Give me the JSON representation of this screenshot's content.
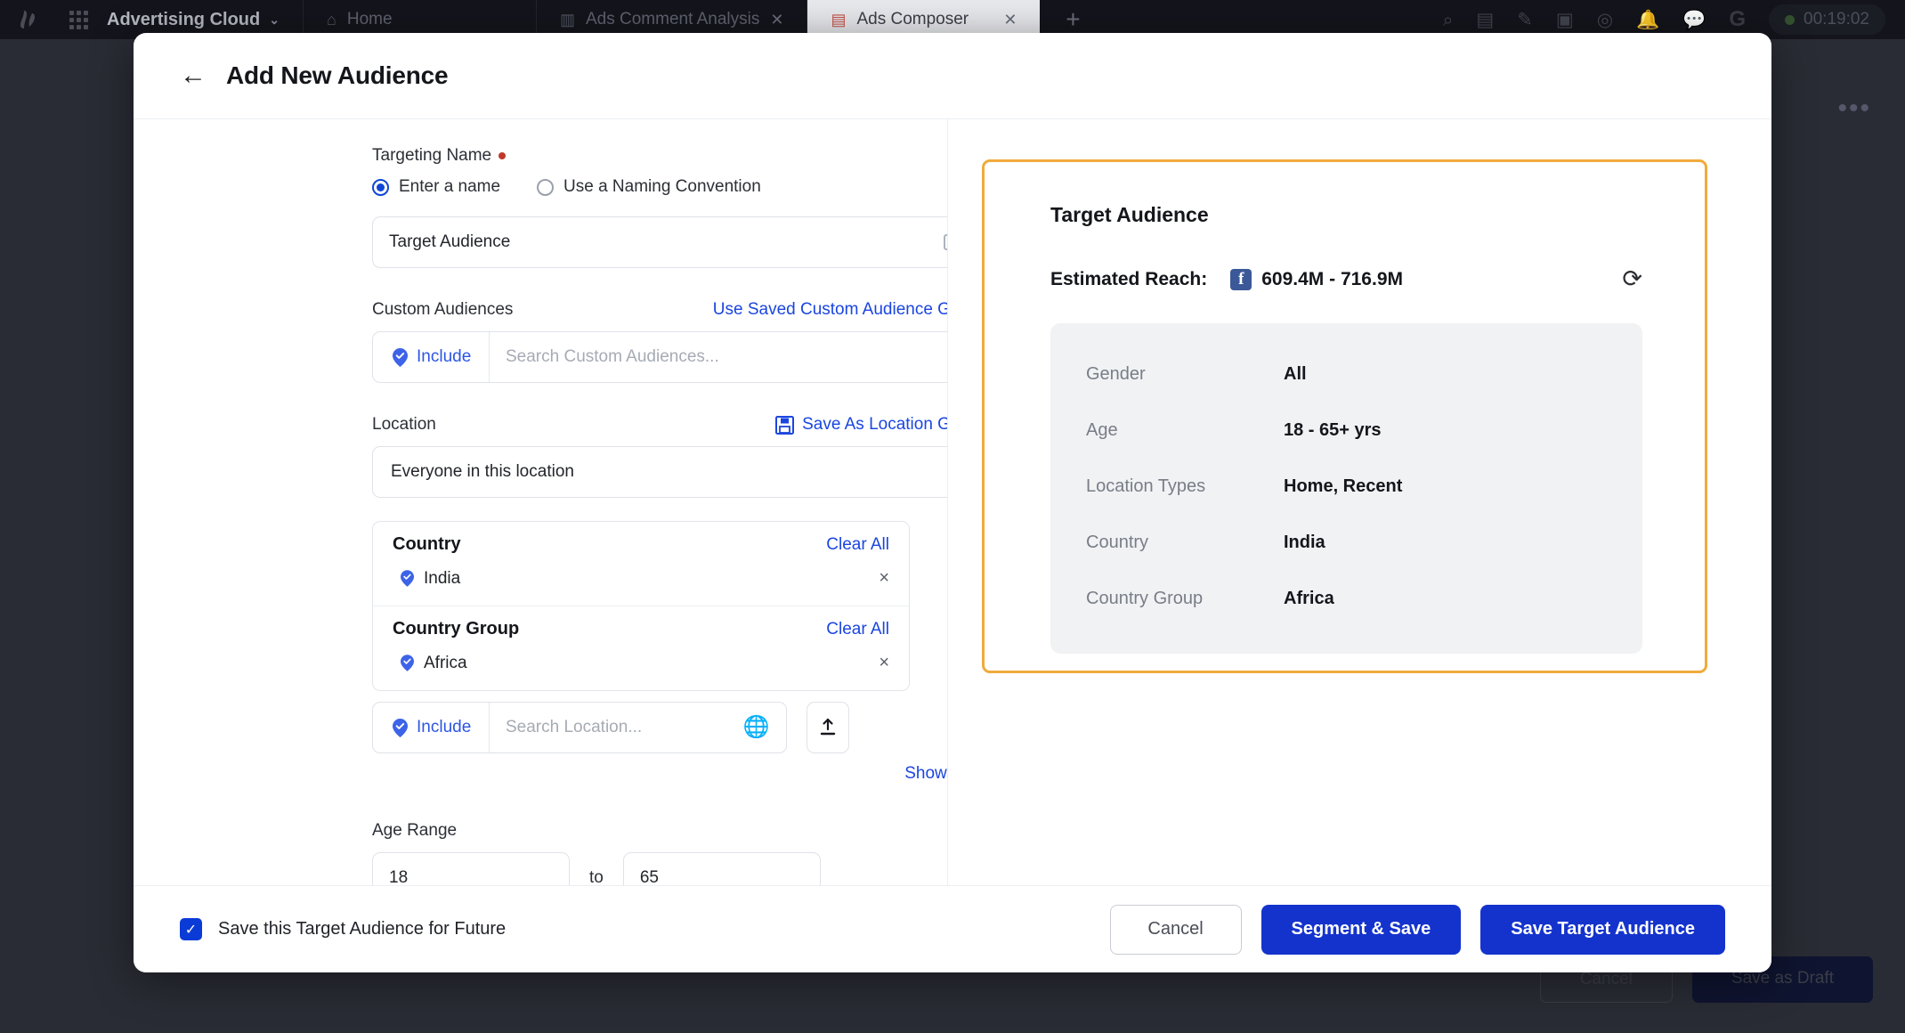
{
  "topbar": {
    "brand": "Advertising Cloud",
    "brand_chevron": "chevron-down",
    "tabs": [
      {
        "label": "Home",
        "icon": "home-icon",
        "active": false,
        "closable": false
      },
      {
        "label": "Ads Comment Analysis",
        "icon": "chart-icon",
        "active": false,
        "closable": true
      },
      {
        "label": "Ads Composer",
        "icon": "composer-icon",
        "active": true,
        "closable": true
      }
    ],
    "new_tab_label": "+",
    "icons": [
      "search-icon",
      "calendar-icon",
      "pencil-icon",
      "schedule-icon",
      "help-icon",
      "bell-icon",
      "chat-icon",
      "google-icon"
    ],
    "clock": "00:19:02"
  },
  "background": {
    "more_menu": "•••",
    "cancel_label": "Cancel",
    "draft_label": "Save as Draft"
  },
  "modal": {
    "title": "Add New Audience",
    "back_icon": "back-arrow-icon"
  },
  "form": {
    "targeting_name": {
      "label": "Targeting Name",
      "required": true,
      "options": [
        {
          "label": "Enter a name",
          "selected": true
        },
        {
          "label": "Use a Naming Convention",
          "selected": false
        }
      ],
      "value": "Target Audience",
      "trailing_icon": "contact-card-icon"
    },
    "custom_audiences": {
      "label": "Custom Audiences",
      "link": "Use Saved Custom Audience Group",
      "include_label": "Include",
      "placeholder": "Search Custom Audiences..."
    },
    "location": {
      "label": "Location",
      "save_link": "Save As Location Group",
      "save_icon": "floppy-disk-icon",
      "dropdown_value": "Everyone in this location",
      "groups": [
        {
          "title": "Country",
          "clear_label": "Clear All",
          "items": [
            {
              "label": "India",
              "icon": "map-pin-check-icon",
              "remove": "×"
            }
          ]
        },
        {
          "title": "Country Group",
          "clear_label": "Clear All",
          "items": [
            {
              "label": "Africa",
              "icon": "map-pin-check-icon",
              "remove": "×"
            }
          ]
        }
      ],
      "include_label": "Include",
      "search_placeholder": "Search Location...",
      "globe_icon": "globe-icon",
      "upload_icon": "upload-icon",
      "show_map_link": "Show Map"
    },
    "age_range": {
      "label": "Age Range",
      "from": "18",
      "to_label": "to",
      "to": "65"
    }
  },
  "preview": {
    "title": "Target Audience",
    "reach_label": "Estimated Reach:",
    "platform_icon": "facebook-icon",
    "reach_value": "609.4M - 716.9M",
    "refresh_icon": "refresh-icon",
    "rows": [
      {
        "key": "Gender",
        "value": "All"
      },
      {
        "key": "Age",
        "value": "18 - 65+ yrs"
      },
      {
        "key": "Location Types",
        "value": "Home, Recent"
      },
      {
        "key": "Country",
        "value": "India"
      },
      {
        "key": "Country Group",
        "value": "Africa"
      }
    ]
  },
  "footer": {
    "checkbox_checked": true,
    "checkbox_label": "Save this Target Audience for Future",
    "cancel": "Cancel",
    "segment_save": "Segment & Save",
    "save_target": "Save Target Audience"
  },
  "colors": {
    "accent_blue": "#1433cd",
    "link_blue": "#1a46e0",
    "highlight_orange": "#f0ab3c",
    "required_red": "#c0392b",
    "topbar_bg": "#14151c"
  }
}
